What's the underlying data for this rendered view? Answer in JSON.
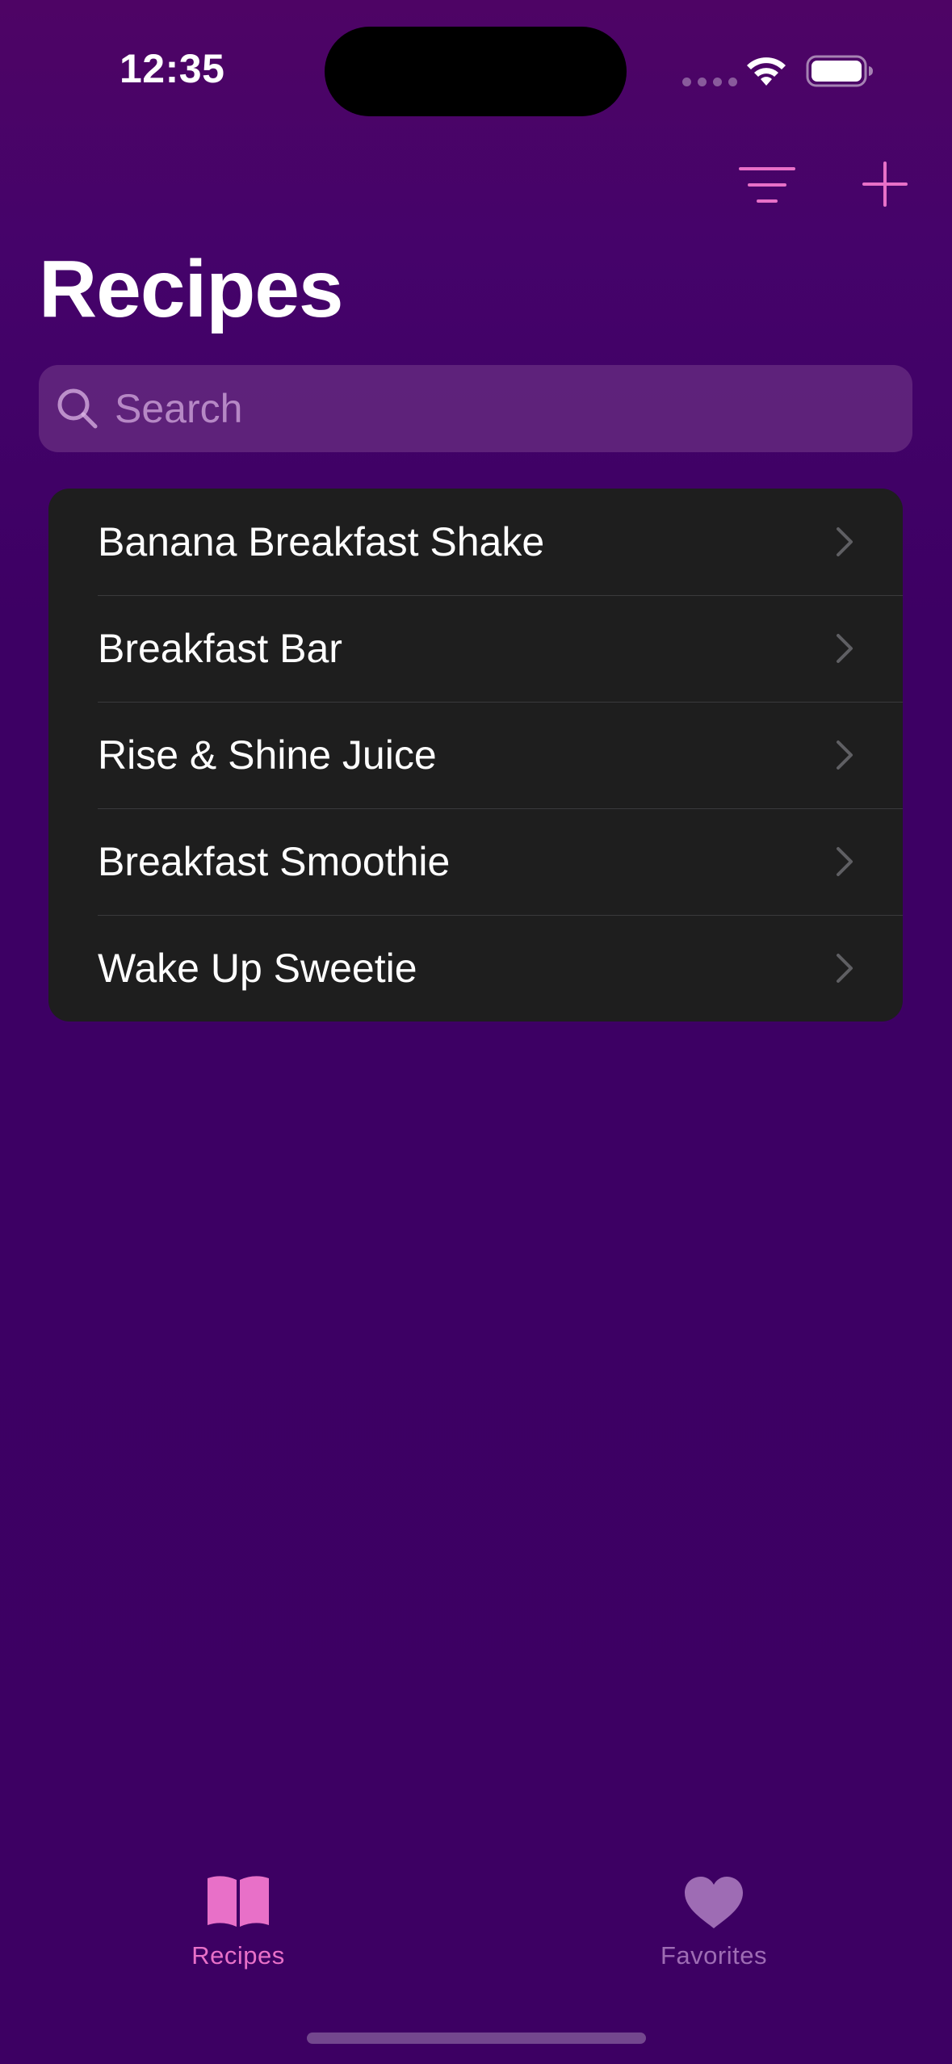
{
  "status_bar": {
    "time": "12:35"
  },
  "nav": {
    "title": "Recipes",
    "filter_icon": "line-horizontal-decrease-icon",
    "add_icon": "plus-icon"
  },
  "search": {
    "placeholder": "Search",
    "value": ""
  },
  "recipes": [
    {
      "label": "Banana Breakfast Shake"
    },
    {
      "label": "Breakfast Bar"
    },
    {
      "label": "Rise & Shine Juice"
    },
    {
      "label": "Breakfast Smoothie"
    },
    {
      "label": "Wake Up Sweetie"
    }
  ],
  "tabs": [
    {
      "label": "Recipes",
      "icon": "book-icon",
      "selected": true
    },
    {
      "label": "Favorites",
      "icon": "heart-icon",
      "selected": false
    }
  ],
  "colors": {
    "accent": "#e870c8",
    "background": "#3d0063",
    "list_background": "#1e1e1e",
    "inactive_tab": "#9e6cb4"
  }
}
